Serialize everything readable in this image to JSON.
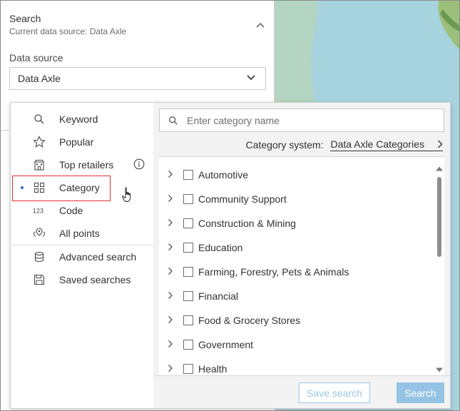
{
  "search_panel": {
    "title": "Search",
    "subtitle": "Current data source: Data Axle",
    "data_source_label": "Data source",
    "data_source_value": "Data Axle"
  },
  "menu": {
    "items": [
      {
        "label": "Keyword",
        "icon": "search-icon"
      },
      {
        "label": "Popular",
        "icon": "star-icon"
      },
      {
        "label": "Top retailers",
        "icon": "store-icon"
      },
      {
        "label": "Category",
        "icon": "grid-icon",
        "active": true
      },
      {
        "label": "Code",
        "icon": "code-123-icon"
      },
      {
        "label": "All points",
        "icon": "points-icon"
      },
      {
        "label": "Advanced search",
        "icon": "database-icon"
      },
      {
        "label": "Saved searches",
        "icon": "save-icon"
      }
    ],
    "info_icon": "info-icon"
  },
  "category_panel": {
    "search_placeholder": "Enter category name",
    "system_label": "Category system:",
    "system_value": "Data Axle Categories",
    "categories": [
      "Automotive",
      "Community Support",
      "Construction & Mining",
      "Education",
      "Farming, Forestry, Pets & Animals",
      "Financial",
      "Food & Grocery Stores",
      "Government",
      "Health"
    ]
  },
  "footer": {
    "save_search_label": "Save search",
    "search_label": "Search"
  },
  "colors": {
    "accent": "#2e6fc0",
    "highlight_border": "#e03030",
    "button_primary": "#95c3e3",
    "map_water": "#a7d3df"
  }
}
